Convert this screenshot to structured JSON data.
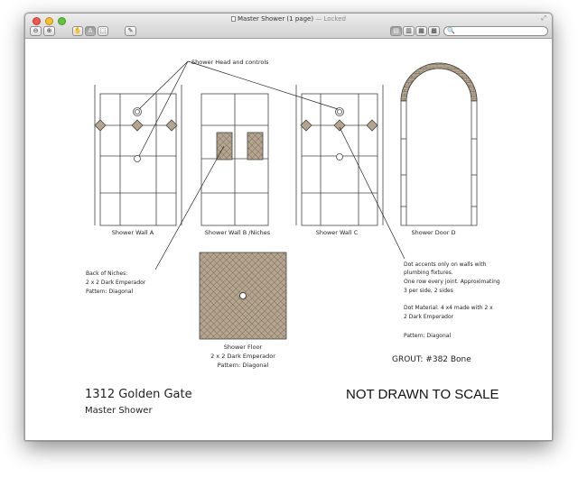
{
  "window": {
    "title": "Master Shower (1 page)",
    "title_suffix": "— Locked",
    "toolbar": {
      "zoom_out": "⊖",
      "zoom_in": "⊕",
      "hand_tool": "✋",
      "text_tool": "A",
      "select_tool": "⬚",
      "annotate_tool": "✎",
      "view_single": "▤",
      "view_two": "▥",
      "view_continuous": "▦",
      "view_grid": "▩",
      "search_placeholder": "🔍"
    }
  },
  "drawing": {
    "callout_top": "Shower Head and controls",
    "wall_labels": [
      "Shower Wall A",
      "Shower Wall B /Niches",
      "Shower Wall C",
      "Shower Door D"
    ],
    "niche_note": [
      "Back of Niches:",
      "2 x 2 Dark Emperador",
      "Pattern: Diagonal"
    ],
    "floor_labels": [
      "Shower Floor",
      "2 x 2 Dark Emperador",
      "Pattern: Diagonal"
    ],
    "dot_note": [
      "Dot accents only on walls with",
      "plumbing fixtures.",
      "One row every joint. Approximating",
      "3 per side, 2 sides",
      "",
      "Dot Material:  4 x4 made with 2 x",
      "2 Dark Emperador",
      "",
      "Pattern: Diagonal"
    ],
    "grout": "GROUT: #382 Bone",
    "project_title": "1312 Golden Gate",
    "project_subtitle": "Master Shower",
    "scale_note": "NOT DRAWN TO SCALE"
  },
  "colors": {
    "tile_fill": "#b5a58f",
    "line": "#333333",
    "window_chrome": "#d8d8d8"
  }
}
